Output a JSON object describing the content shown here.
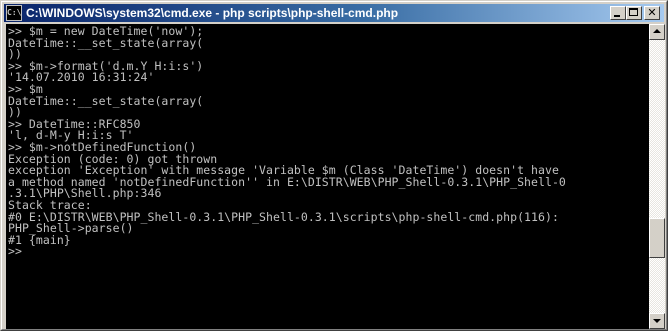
{
  "window": {
    "title": "C:\\WINDOWS\\system32\\cmd.exe - php scripts\\php-shell-cmd.php",
    "sysicon_glyph": "C:\\",
    "buttons": {
      "minimize": "minimize-icon",
      "maximize": "maximize-icon",
      "close": "close-icon"
    }
  },
  "console": {
    "lines": [
      ">> $m = new DateTime('now');",
      "DateTime::__set_state(array(",
      "))",
      ">> $m->format('d.m.Y H:i:s')",
      "'14.07.2010 16:31:24'",
      ">> $m",
      "DateTime::__set_state(array(",
      "))",
      ">> DateTime::RFC850",
      "'l, d-M-y H:i:s T'",
      ">> $m->notDefinedFunction()",
      "Exception (code: 0) got thrown",
      "exception 'Exception' with message 'Variable $m (Class 'DateTime') doesn't have",
      "a method named 'notDefinedFunction'' in E:\\DISTR\\WEB\\PHP_Shell-0.3.1\\PHP_Shell-0",
      ".3.1\\PHP\\Shell.php:346",
      "Stack trace:",
      "#0 E:\\DISTR\\WEB\\PHP_Shell-0.3.1\\PHP_Shell-0.3.1\\scripts\\php-shell-cmd.php(116):",
      "PHP_Shell->parse()",
      "#1 {main}",
      ">>"
    ]
  },
  "colors": {
    "console_bg": "#000000",
    "console_fg": "#c0c0c0",
    "titlebar_start": "#0a246a",
    "titlebar_end": "#a6caf0"
  }
}
